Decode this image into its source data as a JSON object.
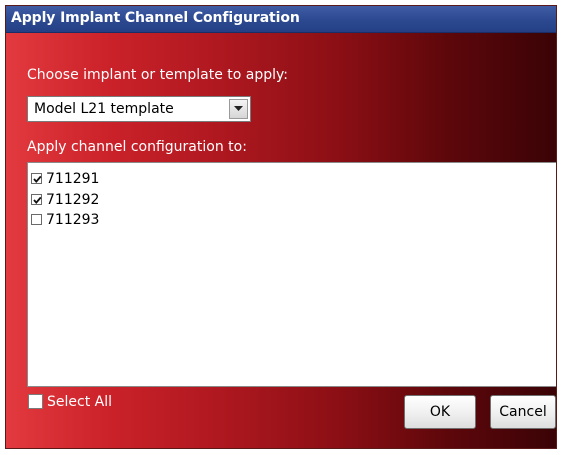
{
  "window": {
    "title": "Apply Implant Channel Configuration"
  },
  "implant_select": {
    "label": "Choose implant or template to apply:",
    "selected_value": "Model L21 template"
  },
  "channels": {
    "label": "Apply channel configuration to:",
    "items": [
      {
        "id": "711291",
        "checked": true
      },
      {
        "id": "711292",
        "checked": true
      },
      {
        "id": "711293",
        "checked": false
      }
    ]
  },
  "select_all": {
    "label": "Select All",
    "checked": false
  },
  "buttons": {
    "ok_label": "OK",
    "cancel_label": "Cancel"
  },
  "icons": {
    "dropdown": "chevron-down-icon",
    "check": "checkmark-icon"
  },
  "colors": {
    "title_bar": "#2d4a92",
    "background_gradient_start": "#e23a3f",
    "background_gradient_end": "#3a0306"
  }
}
